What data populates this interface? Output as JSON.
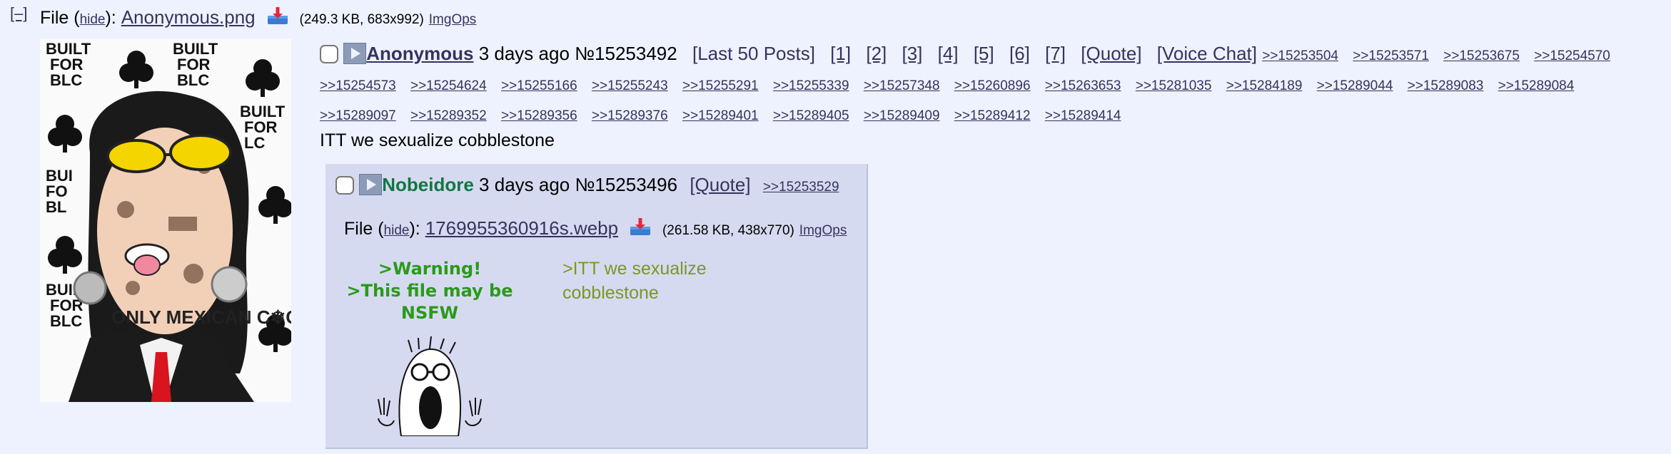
{
  "op": {
    "collapse_toggle": "[–]",
    "file_prefix": "File (",
    "hide_label": "hide",
    "file_sep": "):",
    "file_name": "Anonymous.png",
    "file_meta": "(249.3 KB, 683x992)",
    "imgops_label": "ImgOps",
    "name": "Anonymous",
    "time": "3 days ago",
    "post_no": "№15253492",
    "last50": "[Last 50 Posts]",
    "page_links": [
      "[1]",
      "[2]",
      "[3]",
      "[4]",
      "[5]",
      "[6]",
      "[7]"
    ],
    "quote_label": "[Quote]",
    "voice_chat_label": "[Voice Chat]",
    "replies": [
      ">>15253504",
      ">>15253571",
      ">>15253675",
      ">>15254570",
      ">>15254573",
      ">>15254624",
      ">>15255166",
      ">>15255243",
      ">>15255291",
      ">>15255339",
      ">>15257348",
      ">>15260896",
      ">>15263653",
      ">>15281035",
      ">>15284189",
      ">>15289044",
      ">>15289083",
      ">>15289084",
      ">>15289097",
      ">>15289352",
      ">>15289356",
      ">>15289376",
      ">>15289401",
      ">>15289405",
      ">>15289409",
      ">>15289412",
      ">>15289414"
    ],
    "comment": "ITT we sexualize cobblestone",
    "image_text": {
      "banner": "BUILT FOR BLC",
      "face_text": "ONLY MEXICAN C❄CKS!!"
    }
  },
  "reply": {
    "name": "Nobeidore",
    "time": "3 days ago",
    "post_no": "№15253496",
    "quote_label": "[Quote]",
    "backlink": ">>15253529",
    "file_prefix": "File (",
    "hide_label": "hide",
    "file_sep": "):",
    "file_name": "1769955360916s.webp",
    "file_meta": "(261.58 KB, 438x770)",
    "imgops_label": "ImgOps",
    "warning_lines": [
      ">Warning!",
      ">This file may be",
      "NSFW"
    ],
    "comment": ">ITT we sexualize cobblestone"
  },
  "colors": {
    "background": "#eef2ff",
    "link": "#34345c",
    "reply_bg": "#d6daf0",
    "reply_name": "#117743",
    "greentext": "#789922",
    "warning": "#2a9a1a"
  },
  "icons": [
    "download-icon",
    "play-icon",
    "checkbox"
  ]
}
